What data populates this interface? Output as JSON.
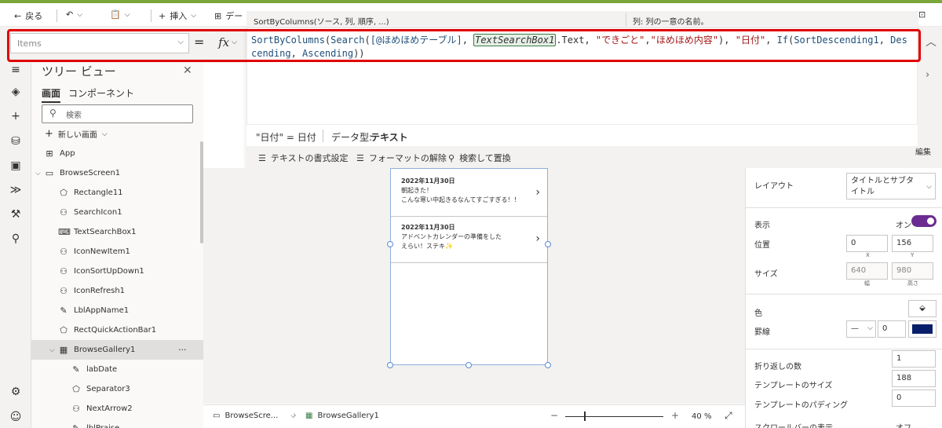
{
  "topbar": {
    "back": "戻る",
    "insert": "挿入",
    "partial": "デー"
  },
  "tooltip": {
    "signature": "SortByColumns(ソース, 列, 順序, ...)",
    "help": "列: 列の一意の名前。"
  },
  "formula_bar": {
    "property": "Items",
    "equals": "=",
    "fx": "fx",
    "formula_parts": [
      {
        "t": "SortByColumns",
        "c": "fn"
      },
      {
        "t": "(",
        "c": "plain"
      },
      {
        "t": "Search",
        "c": "fn"
      },
      {
        "t": "(",
        "c": "plain"
      },
      {
        "t": "[@ほめほめテーブル]",
        "c": "ref"
      },
      {
        "t": ", ",
        "c": "plain"
      },
      {
        "t": "TextSearchBox1",
        "c": "hl"
      },
      {
        "t": ".Text, ",
        "c": "plain"
      },
      {
        "t": "\"できごと\"",
        "c": "str"
      },
      {
        "t": ",",
        "c": "plain"
      },
      {
        "t": "\"ほめほめ内容\"",
        "c": "str"
      },
      {
        "t": "), ",
        "c": "plain"
      },
      {
        "t": "\"日付\"",
        "c": "str"
      },
      {
        "t": ", ",
        "c": "plain"
      },
      {
        "t": "If",
        "c": "fn"
      },
      {
        "t": "(",
        "c": "plain"
      },
      {
        "t": "SortDescending1",
        "c": "ctl"
      },
      {
        "t": ", ",
        "c": "plain"
      },
      {
        "t": "Descending",
        "c": "ctl"
      },
      {
        "t": ", ",
        "c": "plain"
      },
      {
        "t": "Ascending",
        "c": "ctl"
      },
      {
        "t": "))",
        "c": "plain"
      }
    ],
    "result_expr": "\"日付\"  =  日付",
    "data_type_label": "データ型:",
    "data_type_value": "テキスト",
    "format_text": "テキストの書式設定",
    "remove_format": "フォーマットの解除",
    "find_replace": "検索して置換"
  },
  "tree": {
    "title": "ツリー ビュー",
    "tab_screens": "画面",
    "tab_components": "コンポーネント",
    "search_placeholder": "検索",
    "new_screen": "新しい画面",
    "items": [
      {
        "label": "App",
        "icon": "app-icon",
        "glyph": "⊞",
        "indent": 16
      },
      {
        "label": "BrowseScreen1",
        "icon": "screen-icon",
        "glyph": "▭",
        "indent": 16,
        "caret": "⌵"
      },
      {
        "label": "Rectangle11",
        "icon": "shape-icon",
        "glyph": "⬠",
        "indent": 34
      },
      {
        "label": "SearchIcon1",
        "icon": "icon-control-icon",
        "glyph": "⚇",
        "indent": 34
      },
      {
        "label": "TextSearchBox1",
        "icon": "textinput-icon",
        "glyph": "⌨",
        "indent": 34
      },
      {
        "label": "IconNewItem1",
        "icon": "icon-control-icon",
        "glyph": "⚇",
        "indent": 34
      },
      {
        "label": "IconSortUpDown1",
        "icon": "icon-control-icon",
        "glyph": "⚇",
        "indent": 34
      },
      {
        "label": "IconRefresh1",
        "icon": "icon-control-icon",
        "glyph": "⚇",
        "indent": 34
      },
      {
        "label": "LblAppName1",
        "icon": "label-icon",
        "glyph": "✎",
        "indent": 34
      },
      {
        "label": "RectQuickActionBar1",
        "icon": "shape-icon",
        "glyph": "⬠",
        "indent": 34
      },
      {
        "label": "BrowseGallery1",
        "icon": "gallery-icon",
        "glyph": "▦",
        "indent": 34,
        "caret": "⌵",
        "selected": true,
        "more": "···"
      },
      {
        "label": "labDate",
        "icon": "label-icon",
        "glyph": "✎",
        "indent": 50
      },
      {
        "label": "Separator3",
        "icon": "shape-icon",
        "glyph": "⬠",
        "indent": 50
      },
      {
        "label": "NextArrow2",
        "icon": "icon-control-icon",
        "glyph": "⚇",
        "indent": 50
      },
      {
        "label": "lblPraise",
        "icon": "label-icon",
        "glyph": "✎",
        "indent": 50
      }
    ]
  },
  "gallery": {
    "items": [
      {
        "date": "2022年11月30日",
        "text": "朝起きた！\nこんな寒い中起きるなんてすごすぎる！！"
      },
      {
        "date": "2022年11月30日",
        "text": "アドベントカレンダーの準備をした\nえらい！ステキ✨"
      }
    ]
  },
  "status": {
    "screen": "BrowseScre...",
    "gallery": "BrowseGallery1",
    "zoom": "40",
    "zoom_unit": "%"
  },
  "props": {
    "edit": "編集",
    "layout_label": "レイアウト",
    "layout_value": "タイトルとサブタイトル",
    "visible_label": "表示",
    "visible_value": "オン",
    "position_label": "位置",
    "x": "0",
    "y": "156",
    "x_label": "X",
    "y_label": "Y",
    "size_label": "サイズ",
    "width": "640",
    "height": "980",
    "width_label": "幅",
    "height_label": "高さ",
    "color_label": "色",
    "border_label": "罫線",
    "border_width": "0",
    "border_color": "#0a1f6b",
    "wrap_label": "折り返しの数",
    "wrap_value": "1",
    "template_size_label": "テンプレートのサイズ",
    "template_size_value": "188",
    "template_padding_label": "テンプレートのパディング",
    "template_padding_value": "0",
    "scrollbar_label": "スクロールバーの表示",
    "scrollbar_value": "オフ"
  },
  "colors": {
    "toggle_on": "#6b2c91",
    "highlight_border": "#e00000"
  }
}
